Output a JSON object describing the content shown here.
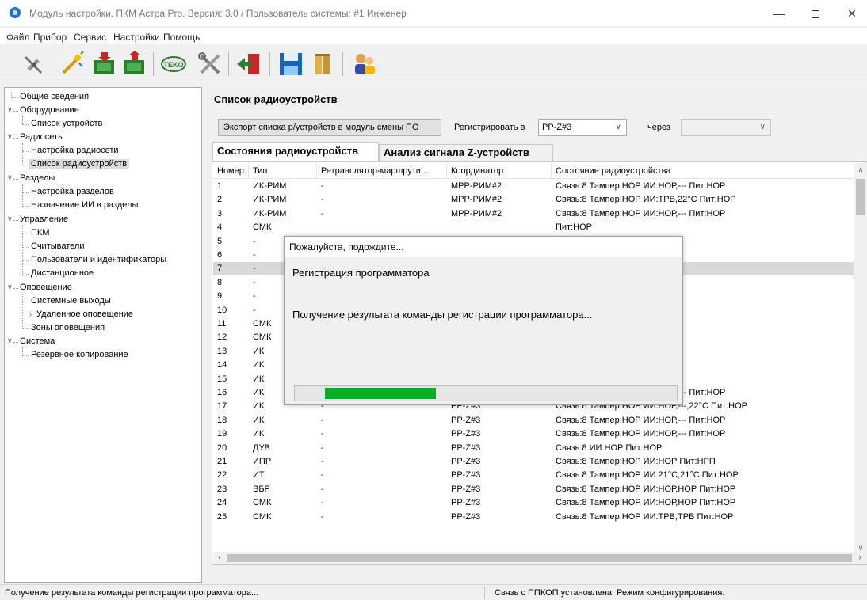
{
  "window": {
    "title": "Модуль настройки. ПКМ Астра Pro. Версия: 3.0 / Пользователь системы: #1 Инженер",
    "minimize": "—",
    "close": "✕"
  },
  "menu": [
    "Файл",
    "Прибор",
    "Сервис",
    "Настройки",
    "Помощь"
  ],
  "toolbar": {
    "teko_label": "TEKO",
    "icons": [
      "satellite-icon",
      "wand-icon",
      "device-read-icon",
      "device-write-icon",
      "teko-icon",
      "tools-icon",
      "exit-icon",
      "save-icon",
      "open-icon",
      "users-icon"
    ]
  },
  "tree": [
    {
      "label": "Общие сведения",
      "level": 0
    },
    {
      "label": "Оборудование",
      "level": 0,
      "expanded": true
    },
    {
      "label": "Список устройств",
      "level": 1
    },
    {
      "label": "Радиосеть",
      "level": 0,
      "expanded": true
    },
    {
      "label": "Настройка радиосети",
      "level": 1
    },
    {
      "label": "Список радиоустройств",
      "level": 1,
      "selected": true
    },
    {
      "label": "Разделы",
      "level": 0,
      "expanded": true
    },
    {
      "label": "Настройка разделов",
      "level": 1
    },
    {
      "label": "Назначение ИИ в разделы",
      "level": 1
    },
    {
      "label": "Управление",
      "level": 0,
      "expanded": true
    },
    {
      "label": "ПКМ",
      "level": 1
    },
    {
      "label": "Считыватели",
      "level": 1
    },
    {
      "label": "Пользователи и идентификаторы",
      "level": 1
    },
    {
      "label": "Дистанционное",
      "level": 1
    },
    {
      "label": "Оповещение",
      "level": 0,
      "expanded": true
    },
    {
      "label": "Системные выходы",
      "level": 1
    },
    {
      "label": "Удаленное оповещение",
      "level": 1,
      "collapsed": true
    },
    {
      "label": "Зоны оповещения",
      "level": 1
    },
    {
      "label": "Система",
      "level": 0,
      "expanded": true
    },
    {
      "label": "Резервное копирование",
      "level": 1
    }
  ],
  "main": {
    "title": "Список радиоустройств",
    "export_button": "Экспорт списка р/устройств в модуль смены ПО",
    "register_label": "Регистрировать в",
    "register_value": "РР-Z#3",
    "via_label": "через",
    "via_value": "",
    "tabs": [
      "Состояния радиоустройств",
      "Анализ сигнала Z-устройств"
    ],
    "active_tab": 0
  },
  "table": {
    "columns": [
      "Номер",
      "Тип",
      "Ретранслятор-маршрути...",
      "Координатор",
      "Состояние радиоустройства"
    ],
    "highlight_row": 7,
    "rows": [
      [
        "1",
        "ИК-РИМ",
        "-",
        "МРР-РИМ#2",
        "Связь:8 Тампер:НОР ИИ:НОР,--- Пит:НОР"
      ],
      [
        "2",
        "ИК-РИМ",
        "-",
        "МРР-РИМ#2",
        "Связь:8 Тампер:НОР ИИ:ТРВ,22°С Пит:НОР"
      ],
      [
        "3",
        "ИК-РИМ",
        "-",
        "МРР-РИМ#2",
        "Связь:8 Тампер:НОР ИИ:НОР,--- Пит:НОР"
      ],
      [
        "4",
        "СМК",
        "",
        "",
        "Пит:НОР"
      ],
      [
        "5",
        "-",
        "",
        "",
        ""
      ],
      [
        "6",
        "-",
        "",
        "",
        ""
      ],
      [
        "7",
        "-",
        "",
        "",
        ""
      ],
      [
        "8",
        "-",
        "",
        "",
        ""
      ],
      [
        "9",
        "-",
        "",
        "",
        ""
      ],
      [
        "10",
        "-",
        "",
        "",
        ""
      ],
      [
        "11",
        "СМК",
        "",
        "",
        ",НОР Пит:НОР"
      ],
      [
        "12",
        "СМК",
        "",
        "",
        ",НОР Пит:НОР"
      ],
      [
        "13",
        "ИК",
        "",
        "",
        ",--- Пит:НОР"
      ],
      [
        "14",
        "ИК",
        "",
        "",
        ",--- Пит:НОР"
      ],
      [
        "15",
        "ИК",
        "",
        "",
        ",--- Пит:НОР"
      ],
      [
        "16",
        "ИК",
        "-",
        "РР-Z#3",
        "Связь:8 Тампер:НОР ИИ:НОР,--- Пит:НОР"
      ],
      [
        "17",
        "ИК",
        "-",
        "РР-Z#3",
        "Связь:8 Тампер:НОР ИИ:НОР,---,22°С Пит:НОР"
      ],
      [
        "18",
        "ИК",
        "-",
        "РР-Z#3",
        "Связь:8 Тампер:НОР ИИ:НОР,--- Пит:НОР"
      ],
      [
        "19",
        "ИК",
        "-",
        "РР-Z#3",
        "Связь:8 Тампер:НОР ИИ:НОР,--- Пит:НОР"
      ],
      [
        "20",
        "ДУВ",
        "-",
        "РР-Z#3",
        "Связь:8 ИИ:НОР Пит:НОР"
      ],
      [
        "21",
        "ИПР",
        "-",
        "РР-Z#3",
        "Связь:8 Тампер:НОР ИИ:НОР Пит:НРП"
      ],
      [
        "22",
        "ИТ",
        "-",
        "РР-Z#3",
        "Связь:8 Тампер:НОР ИИ:21°С,21°С Пит:НОР"
      ],
      [
        "23",
        "ВБР",
        "-",
        "РР-Z#3",
        "Связь:8 Тампер:НОР ИИ:НОР,НОР Пит:НОР"
      ],
      [
        "24",
        "СМК",
        "-",
        "РР-Z#3",
        "Связь:8 Тампер:НОР ИИ:НОР,НОР Пит:НОР"
      ],
      [
        "25",
        "СМК",
        "-",
        "РР-Z#3",
        "Связь:8 Тампер:НОР ИИ:ТРВ,ТРВ Пит:НОР"
      ]
    ]
  },
  "dialog": {
    "title": "Пожалуйста, подождите...",
    "line1": "Регистрация программатора",
    "line2": "Получение результата команды регистрации программатора...",
    "progress": 0.29
  },
  "status": {
    "left": "Получение результата команды регистрации программатора...",
    "right": "Связь с ППКОП установлена. Режим конфигурирования."
  },
  "colors": {
    "progress_fill": "#06b025",
    "app_icon": "#2a6fd6",
    "selection": "#d9d9d9"
  }
}
